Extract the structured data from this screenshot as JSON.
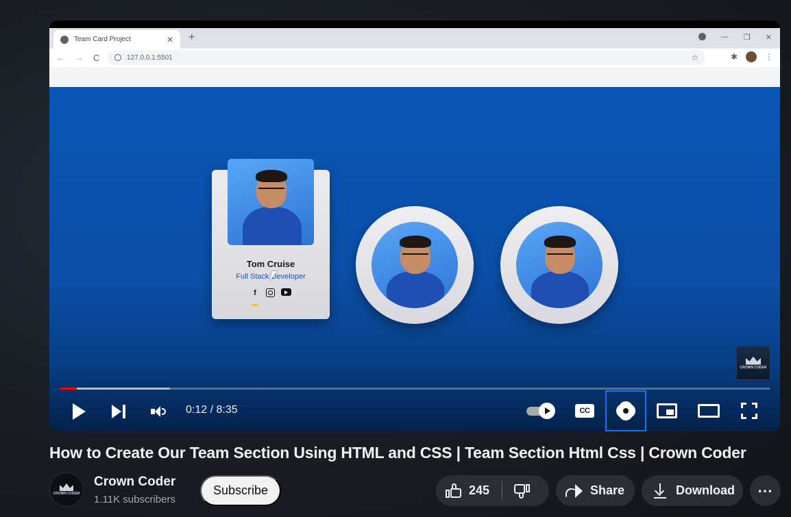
{
  "browser": {
    "tab_title": "Team Card Project",
    "tab_close": "✕",
    "new_tab": "+",
    "url": "127.0.0.1:5501",
    "back": "←",
    "forward": "→",
    "reload": "C",
    "star": "☆",
    "minimize": "—",
    "restore": "❐",
    "close": "✕",
    "extensions": "✱",
    "menu": "⋮"
  },
  "page": {
    "card_name": "Tom Cruise",
    "card_role": "Full Stack Developer",
    "social_facebook": "f",
    "watermark_text": "CROWN CODER"
  },
  "player": {
    "time": "0:12 / 8:35",
    "cc_label": "CC",
    "progress_played_fraction": 0.024,
    "progress_buffered_fraction": 0.155
  },
  "video": {
    "title": "How to Create Our Team Section Using HTML and CSS | Team Section Html Css | Crown Coder"
  },
  "channel": {
    "name": "Crown Coder",
    "subscribers": "1.11K subscribers",
    "avatar_text": "CROWN CODER",
    "subscribe_label": "Subscribe"
  },
  "actions": {
    "like_count": "245",
    "share_label": "Share",
    "download_label": "Download",
    "more_label": "⋯"
  },
  "colors": {
    "progress_red": "#ff0000",
    "stage_blue": "#0a56b6",
    "focus_outline": "#1a73e8"
  }
}
